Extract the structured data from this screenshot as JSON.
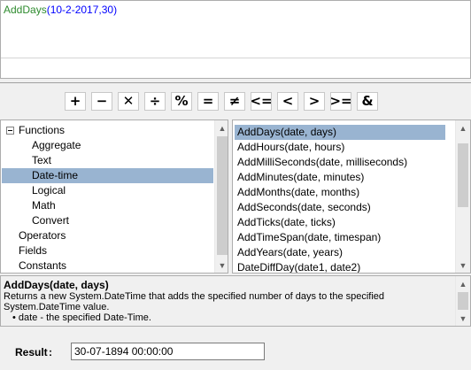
{
  "editor": {
    "fn_name": "AddDays",
    "fn_args": "(10-2-2017,30)"
  },
  "toolbar": {
    "operators": [
      {
        "name": "plus-button",
        "glyph": "+"
      },
      {
        "name": "minus-button",
        "glyph": "−"
      },
      {
        "name": "multiply-button",
        "glyph": "✕"
      },
      {
        "name": "divide-button",
        "glyph": "÷"
      },
      {
        "name": "modulo-button",
        "glyph": "%"
      },
      {
        "name": "equals-button",
        "glyph": "="
      },
      {
        "name": "not-equals-button",
        "glyph": "≠"
      },
      {
        "name": "less-or-equal-button",
        "glyph": "<="
      },
      {
        "name": "less-than-button",
        "glyph": "<"
      },
      {
        "name": "greater-than-button",
        "glyph": ">"
      },
      {
        "name": "greater-or-equal-button",
        "glyph": ">="
      },
      {
        "name": "ampersand-button",
        "glyph": "&"
      }
    ]
  },
  "tree": {
    "items": [
      {
        "label": "Functions",
        "level": 0,
        "expanded": true
      },
      {
        "label": "Aggregate",
        "level": 1
      },
      {
        "label": "Text",
        "level": 1
      },
      {
        "label": "Date-time",
        "level": 1,
        "selected": true
      },
      {
        "label": "Logical",
        "level": 1
      },
      {
        "label": "Math",
        "level": 1
      },
      {
        "label": "Convert",
        "level": 1
      },
      {
        "label": "Operators",
        "level": 0
      },
      {
        "label": "Fields",
        "level": 0
      },
      {
        "label": "Constants",
        "level": 0
      }
    ]
  },
  "functions": {
    "items": [
      {
        "label": "AddDays(date, days)",
        "selected": true
      },
      {
        "label": "AddHours(date, hours)"
      },
      {
        "label": "AddMilliSeconds(date, milliseconds)"
      },
      {
        "label": "AddMinutes(date, minutes)"
      },
      {
        "label": "AddMonths(date, months)"
      },
      {
        "label": "AddSeconds(date, seconds)"
      },
      {
        "label": "AddTicks(date, ticks)"
      },
      {
        "label": "AddTimeSpan(date, timespan)"
      },
      {
        "label": "AddYears(date, years)"
      },
      {
        "label": "DateDiffDay(date1, date2)"
      }
    ]
  },
  "description": {
    "title": "AddDays(date, days)",
    "body": "Returns a new System.DateTime that adds the specified number of days to the specified System.DateTime value.",
    "param": "• date - the specified Date-Time."
  },
  "result": {
    "label": "Result",
    "colon": ":",
    "value": "30-07-1894 00:00:00"
  },
  "colors": {
    "selection": "#99b4d1",
    "fn_name": "#2e8b2e",
    "fn_args": "#0000ff"
  }
}
